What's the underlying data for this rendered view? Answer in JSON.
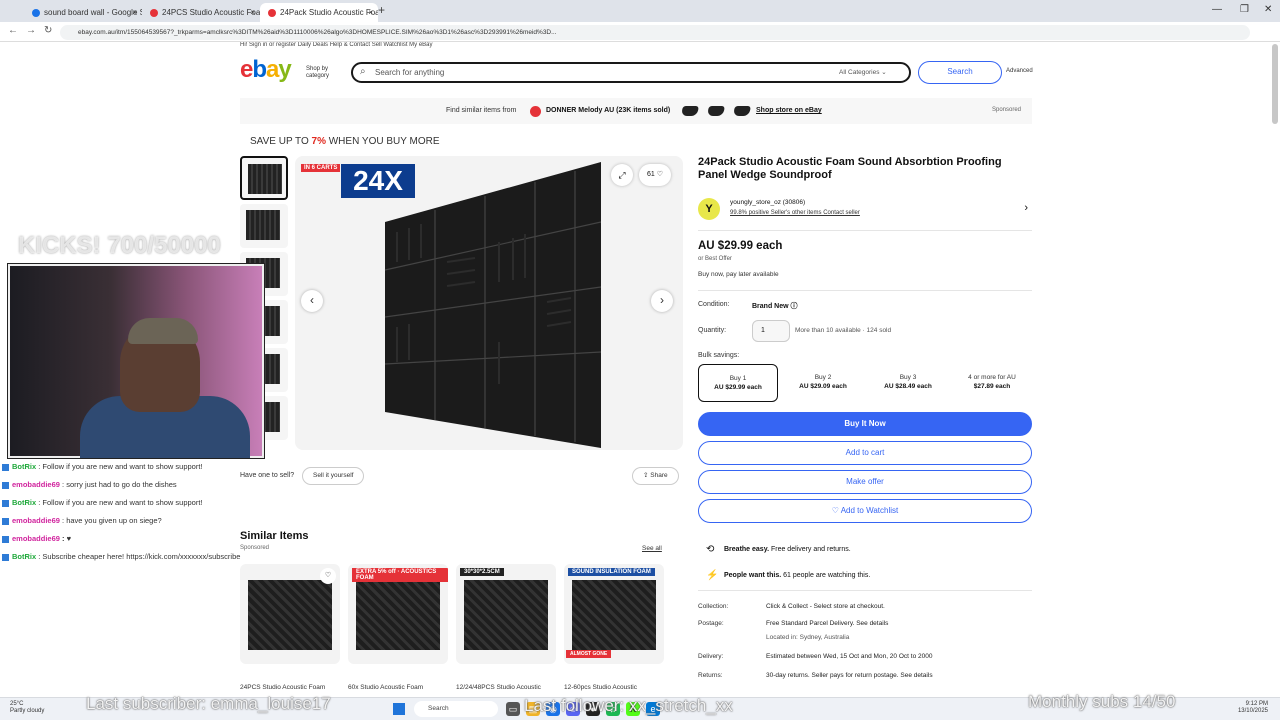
{
  "browser": {
    "tabs": [
      {
        "label": "sound board wall - Google Se"
      },
      {
        "label": "24PCS Studio Acoustic Foam S"
      },
      {
        "label": "24Pack Studio Acoustic Foam S"
      }
    ],
    "new_tab": "+",
    "url": "ebay.com.au/itm/155064539567?_trkparms=amclksrc%3DITM%26aid%3D1110006%26algo%3DHOMESPLICE.SIM%26ao%3D1%26asc%3D293991%26meid%3D..."
  },
  "ebay": {
    "topnav": "Hi! Sign in or register   Daily Deals   Help & Contact          Sell   Watchlist   My eBay",
    "logo_e": "e",
    "logo_b": "b",
    "logo_a": "a",
    "logo_y": "y",
    "shop_by": "Shop by",
    "category": "category",
    "search_placeholder": "Search for anything",
    "all_categories": "All Categories",
    "search_button": "Search",
    "advanced": "Advanced",
    "promo": {
      "find_similar": "Find similar items from",
      "store": "DONNER Melody AU  (23K items sold)",
      "shop_store": "Shop store on eBay",
      "sponsored": "Sponsored"
    },
    "save_prefix": "SAVE UP TO ",
    "save_pct": "7%",
    "save_suffix": " WHEN YOU BUY MORE",
    "image": {
      "badge": "IN 6 CARTS",
      "big_label": "24X",
      "watch_count": "61"
    },
    "sell_prompt": "Have one to sell?",
    "sell_button": "Sell it yourself",
    "share_button": "Share",
    "title": "24Pack Studio Acoustic Foam Sound Absorbtion Proofing Panel Wedge Soundproof",
    "seller": {
      "avatar": "Y",
      "name": "youngly_store_oz (30806)",
      "links": "99.8% positive   Seller's other items   Contact seller"
    },
    "price": "AU $29.99 each",
    "best_offer": "or Best Offer",
    "bnpl": "Buy now, pay later available",
    "condition_label": "Condition:",
    "condition_value": "Brand New",
    "quantity_label": "Quantity:",
    "quantity_value": "1",
    "quantity_note": "More than 10 available · 124 sold",
    "bulk_label": "Bulk savings:",
    "bulk": [
      {
        "title": "Buy 1",
        "price": "AU $29.99 each"
      },
      {
        "title": "Buy 2",
        "price": "AU $29.09 each"
      },
      {
        "title": "Buy 3",
        "price": "AU $28.49 each"
      },
      {
        "title": "4 or more for AU",
        "price": "$27.89 each"
      }
    ],
    "buy_now": "Buy It Now",
    "add_cart": "Add to cart",
    "make_offer": "Make offer",
    "add_watch": "♡ Add to Watchlist",
    "perks": [
      {
        "bold": "Breathe easy.",
        "text": " Free delivery and returns."
      },
      {
        "bold": "People want this.",
        "text": " 61 people are watching this."
      }
    ],
    "details": [
      {
        "label": "Collection:",
        "value": "Click & Collect - Select store at checkout."
      },
      {
        "label": "Postage:",
        "value": "Free Standard Parcel Delivery. See details"
      },
      {
        "label": "",
        "value": "Located in: Sydney, Australia"
      },
      {
        "label": "Delivery:",
        "value": "Estimated between Wed, 15 Oct and Mon, 20 Oct to 2000"
      },
      {
        "label": "Returns:",
        "value": "30-day returns. Seller pays for return postage. See details"
      }
    ],
    "similar_title": "Similar Items",
    "similar_sponsored": "Sponsored",
    "see_all": "See all",
    "similar": [
      {
        "tag": "",
        "title": "24PCS Studio Acoustic Foam"
      },
      {
        "tag": "EXTRA 5% off · ACOUSTICS FOAM",
        "title": "60x Studio Acoustic Foam"
      },
      {
        "tag": "30*30*2.5CM",
        "title": "12/24/48PCS Studio Acoustic"
      },
      {
        "tag": "SOUND INSULATION FOAM",
        "title": "12-60pcs Studio Acoustic"
      }
    ],
    "almost_gone": "ALMOST GONE",
    "help": "?"
  },
  "stream": {
    "kicks": "KICKS! 700/50000",
    "chat": [
      {
        "user": "BotRix",
        "type": "bot",
        "msg": " : Follow if you are new and want to show support!"
      },
      {
        "user": "emobaddie69",
        "type": "user",
        "msg": " : sorry just had to go do the dishes"
      },
      {
        "user": "BotRix",
        "type": "bot",
        "msg": " : Follow if you are new and want to show support!"
      },
      {
        "user": "emobaddie69",
        "type": "user",
        "msg": " : have you given up on siege?"
      },
      {
        "user": "emobaddie69",
        "type": "user",
        "msg": " : ♥"
      },
      {
        "user": "BotRix",
        "type": "bot",
        "msg": " : Subscribe cheaper here! https://kick.com/xxxxxxx/subscribe"
      }
    ],
    "last_subscriber": "Last subscriber: emma_louise17",
    "last_follower": "Last follower: xx_stretch_xx",
    "monthly_subs": "Monthly subs 14/50"
  },
  "taskbar": {
    "weather_temp": "25°C",
    "weather_desc": "Partly cloudy",
    "search": "Search",
    "time": "9:12 PM",
    "date": "13/10/2025"
  }
}
